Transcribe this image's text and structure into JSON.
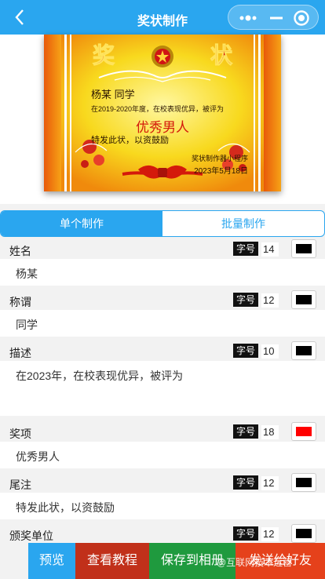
{
  "header": {
    "title": "奖状制作",
    "back_icon": "chevron-left-icon",
    "more_icon": "more-dots-icon",
    "minimize_icon": "minimize-icon",
    "close_icon": "target-close-icon"
  },
  "certificate": {
    "heading_left": "奖",
    "heading_right": "状",
    "name_line": "杨某 同学",
    "description": "在2019-2020年度，在校表现优异，被评为",
    "award": "优秀男人",
    "note": "特发此状，以资鼓励",
    "issuer": "奖状制作器小程序",
    "date": "2023年5月18日"
  },
  "tabs": [
    {
      "label": "单个制作",
      "active": true
    },
    {
      "label": "批量制作",
      "active": false
    }
  ],
  "form": {
    "size_tag": "字号",
    "fields": [
      {
        "label": "姓名",
        "size": "14",
        "color": "#000000",
        "value": "杨某"
      },
      {
        "label": "称谓",
        "size": "12",
        "color": "#000000",
        "value": "同学"
      },
      {
        "label": "描述",
        "size": "10",
        "color": "#000000",
        "value": "在2023年，在校表现优异，被评为"
      },
      {
        "label": "奖项",
        "size": "18",
        "color": "#ff0000",
        "value": "优秀男人"
      },
      {
        "label": "尾注",
        "size": "12",
        "color": "#000000",
        "value": "特发此状，以资鼓励"
      },
      {
        "label": "颁奖单位",
        "size": "12",
        "color": "#000000",
        "value": ""
      }
    ]
  },
  "bottom": {
    "preview": "预览",
    "tutorial": "查看教程",
    "save": "保存到相册",
    "share": "发送给好友",
    "watermark": "@互联网技术运营"
  },
  "colors": {
    "primary": "#2aa6ef",
    "tutorial": "#c1301a",
    "save": "#1f9a3e",
    "share": "#e5411b"
  }
}
